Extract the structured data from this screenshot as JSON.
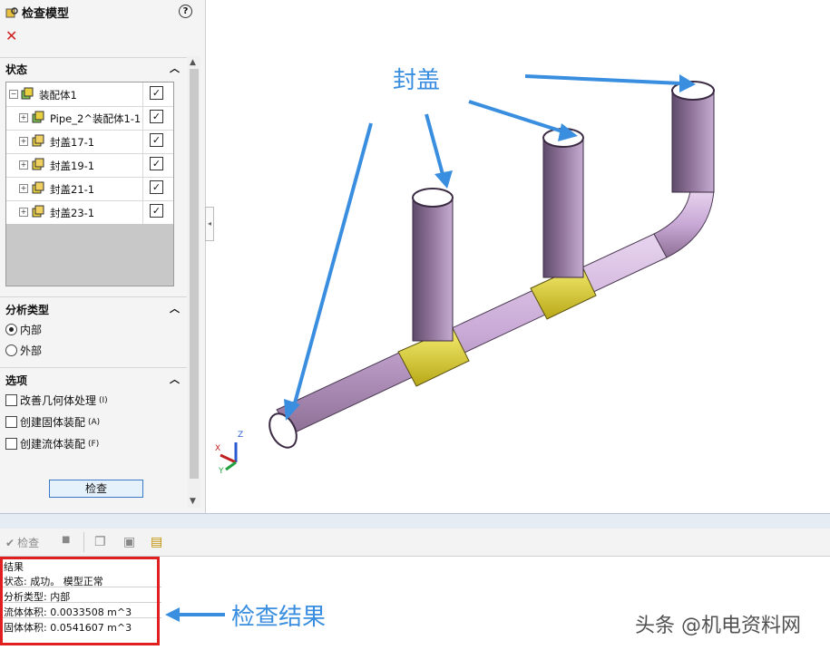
{
  "panel": {
    "title": "检查模型",
    "help_icon": "help-icon",
    "close_icon": "close-icon",
    "status_section": "状态",
    "tree": [
      {
        "label": "装配体1",
        "expand": "−",
        "checked": true
      },
      {
        "label": "Pipe_2^装配体1-1",
        "expand": "+",
        "checked": true
      },
      {
        "label": "封盖17-1",
        "expand": "+",
        "checked": true
      },
      {
        "label": "封盖19-1",
        "expand": "+",
        "checked": true
      },
      {
        "label": "封盖21-1",
        "expand": "+",
        "checked": true
      },
      {
        "label": "封盖23-1",
        "expand": "+",
        "checked": true
      }
    ],
    "analysis_section": "分析类型",
    "analysis_options": [
      {
        "label": "内部",
        "selected": true
      },
      {
        "label": "外部",
        "selected": false
      }
    ],
    "options_section": "选项",
    "options": [
      {
        "label": "改善几何体处理",
        "hotkey": "(I)",
        "checked": false
      },
      {
        "label": "创建固体装配",
        "hotkey": "(A)",
        "checked": false
      },
      {
        "label": "创建流体装配",
        "hotkey": "(F)",
        "checked": false
      }
    ],
    "check_button": "检查"
  },
  "toolbar": {
    "check_label": "检查"
  },
  "results": {
    "header": "结果",
    "lines": [
      "状态: 成功。 模型正常",
      "分析类型: 内部",
      "流体体积: 0.0033508  m^3",
      "固体体积: 0.0541607  m^3"
    ]
  },
  "annotations": {
    "cap_label": "封盖",
    "result_label": "检查结果"
  },
  "axes": {
    "x": "X",
    "y": "Y",
    "z": "Z"
  },
  "watermark": "头条 @机电资料网",
  "colors": {
    "pipe": "#c9a9d6",
    "fitting": "#e3d830",
    "arrow": "#3a8ee0",
    "highlight": "#e02020"
  }
}
